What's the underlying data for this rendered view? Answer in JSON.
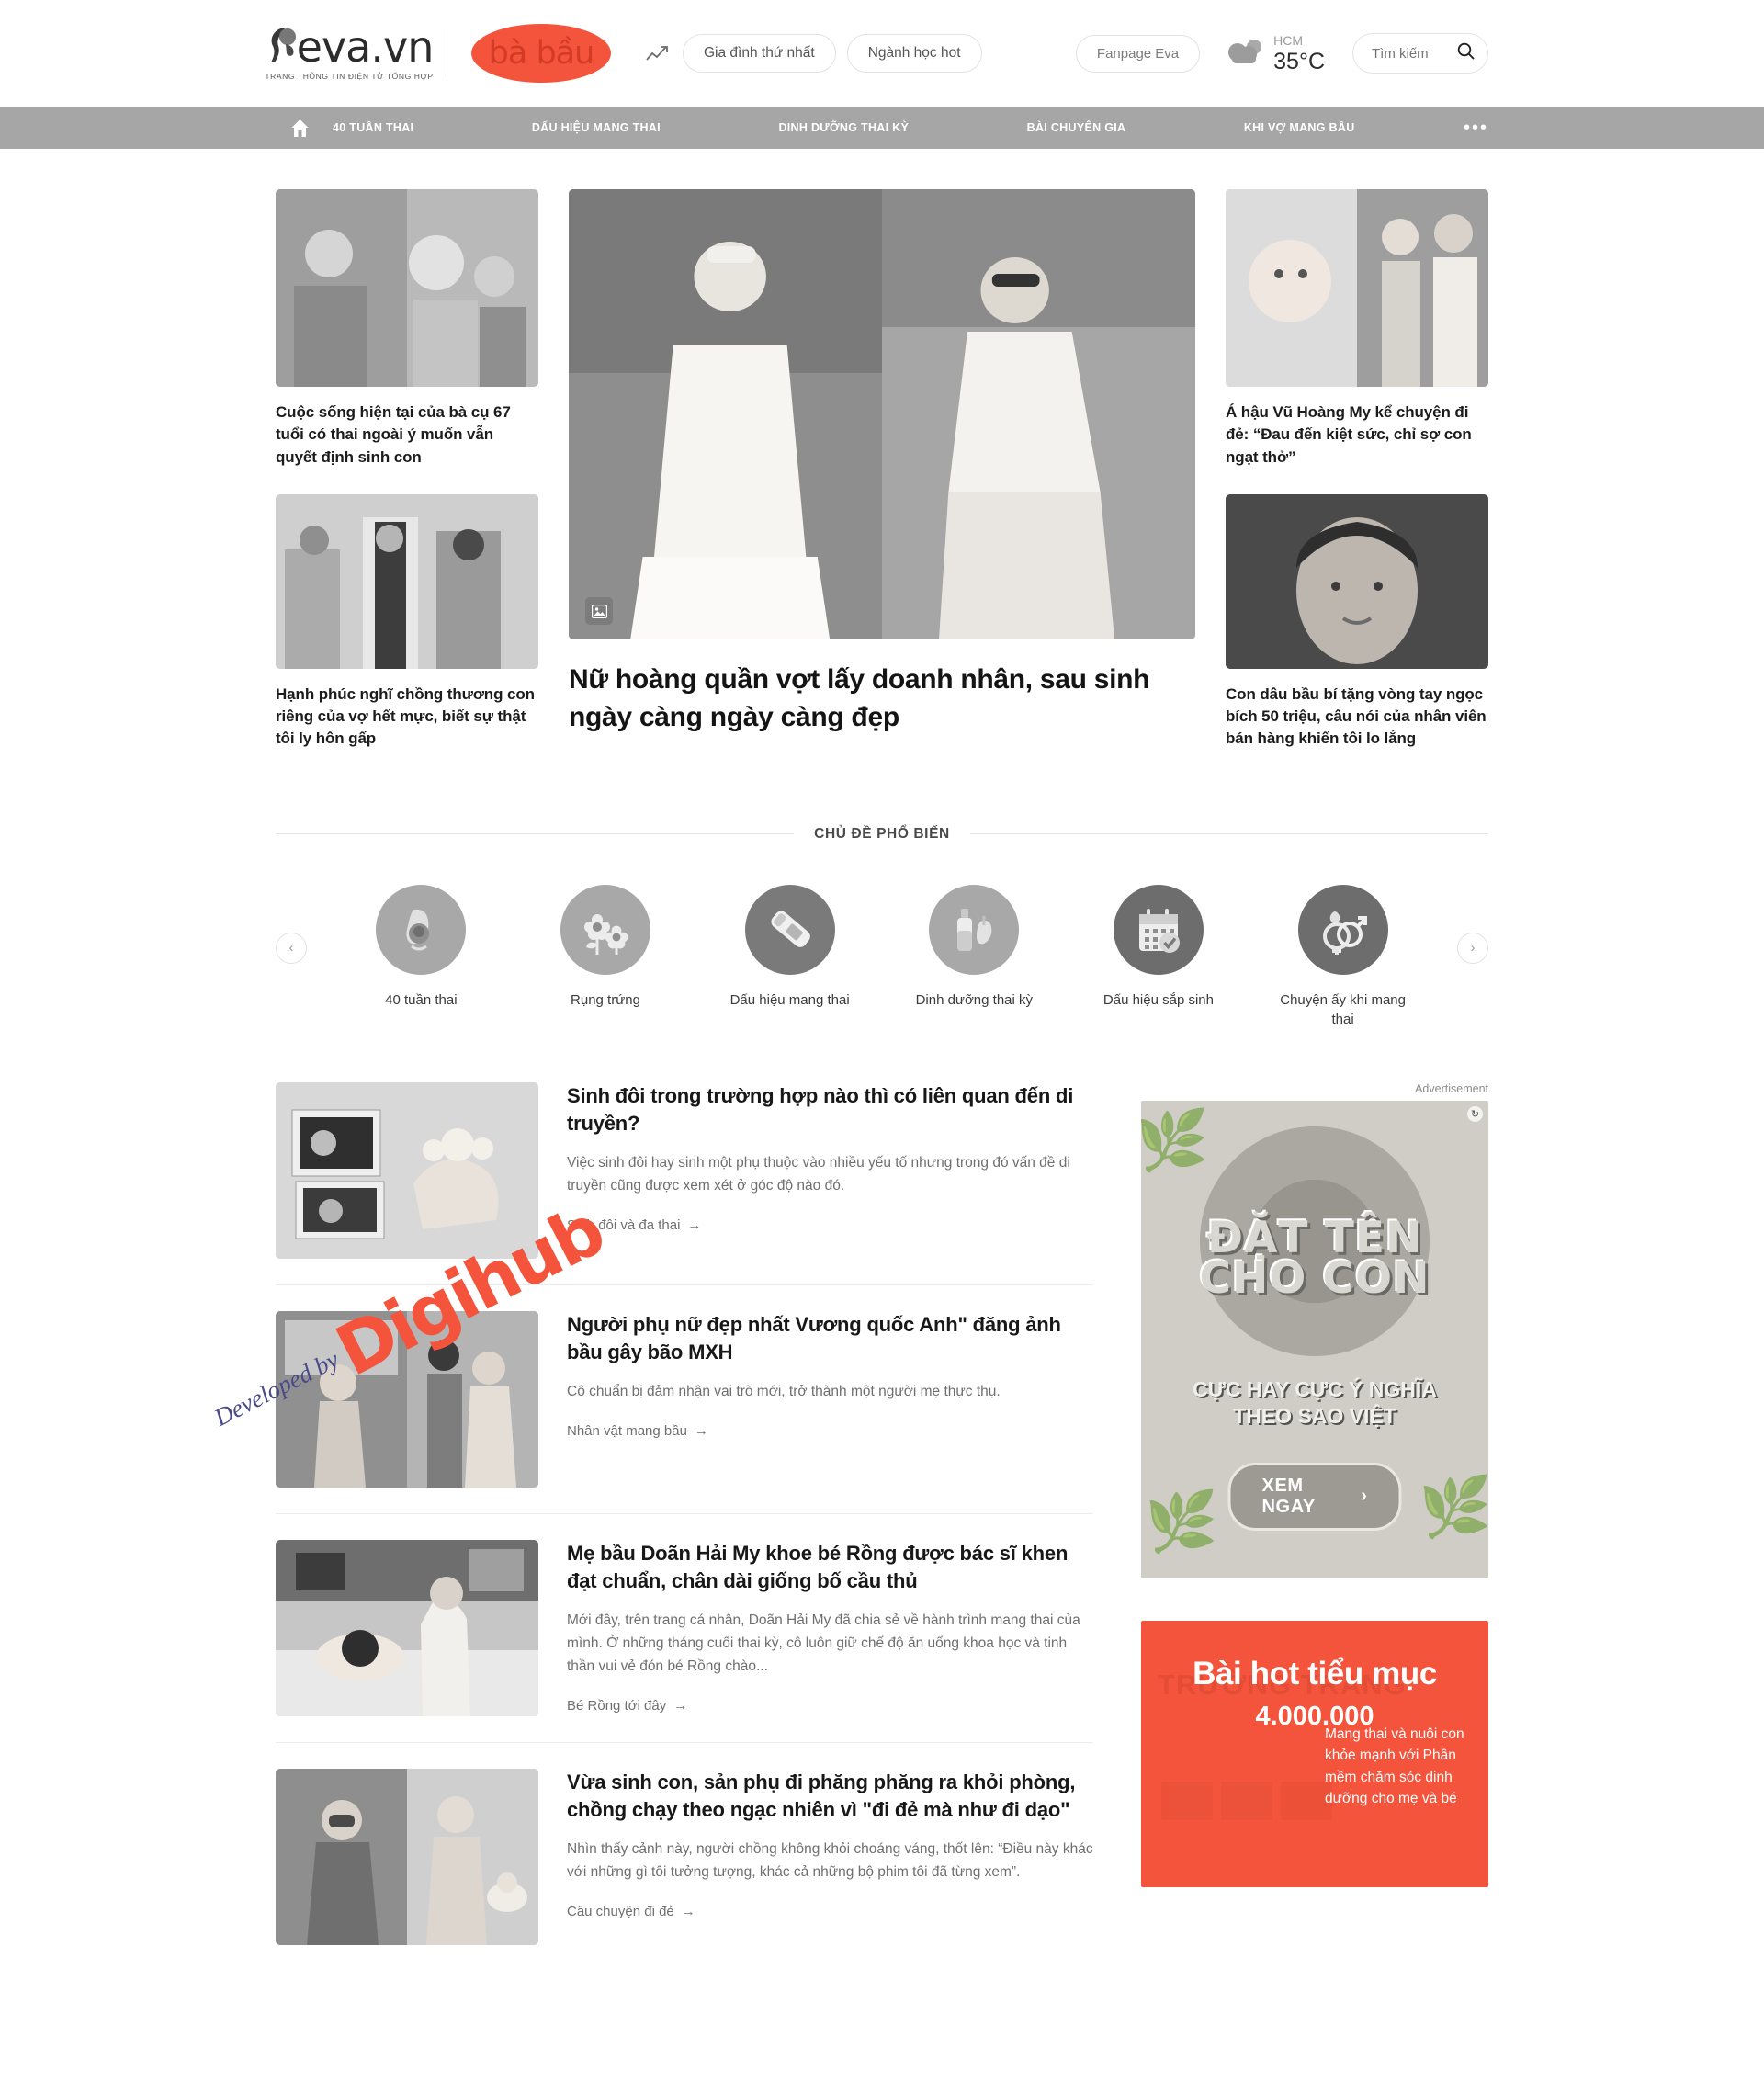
{
  "header": {
    "logo_text": "eva.vn",
    "logo_tagline": "TRANG THÔNG TIN ĐIỆN TỬ TỔNG HỢP",
    "sub_brand": "bà bầu",
    "trend_icon": "trending-up-icon",
    "pills": [
      "Gia đình thứ nhất",
      "Ngành học hot"
    ],
    "fanpage_label": "Fanpage Eva",
    "weather": {
      "city": "HCM",
      "temp": "35°C",
      "icon": "cloud-icon"
    },
    "search": {
      "placeholder": "Tìm kiếm",
      "value": "",
      "icon": "search-icon"
    }
  },
  "nav": {
    "home_icon": "home-icon",
    "items": [
      "40 TUẦN THAI",
      "DẤU HIỆU MANG THAI",
      "DINH DƯỠNG THAI KỲ",
      "BÀI CHUYÊN GIA",
      "KHI VỢ MANG BẦU"
    ],
    "more_label": "•••"
  },
  "hero": {
    "left": [
      {
        "title": "Cuộc sống hiện tại của bà cụ 67 tuổi có thai ngoài ý muốn vẫn quyết định sinh con"
      },
      {
        "title": "Hạnh phúc nghĩ chồng thương con riêng của vợ hết mực, biết sự thật tôi ly hôn gấp"
      }
    ],
    "main": {
      "title": "Nữ hoàng quần vợt lấy doanh nhân, sau sinh ngày càng ngày càng đẹp",
      "badge_icon": "photo-gallery-icon"
    },
    "right": [
      {
        "title": "Á hậu Vũ Hoàng My kể chuyện đi đẻ: “Đau đến kiệt sức, chỉ sợ con ngạt thở”"
      },
      {
        "title": "Con dâu bầu bí tặng vòng tay ngọc bích 50 triệu, câu nói của nhân viên bán hàng khiến tôi lo lắng"
      }
    ]
  },
  "topics_section": {
    "title": "CHỦ ĐỀ PHỔ BIẾN",
    "prev_icon": "chevron-left-icon",
    "next_icon": "chevron-right-icon",
    "items": [
      {
        "label": "40 tuần thai",
        "icon": "pregnant-belly-icon"
      },
      {
        "label": "Rụng trứng",
        "icon": "flowers-icon"
      },
      {
        "label": "Dấu hiệu mang thai",
        "icon": "pregnancy-test-icon"
      },
      {
        "label": "Dinh dưỡng thai kỳ",
        "icon": "nutrition-bottle-icon"
      },
      {
        "label": "Dấu hiệu sắp sinh",
        "icon": "calendar-check-icon"
      },
      {
        "label": "Chuyện ấy khi mang thai",
        "icon": "gender-symbols-icon"
      }
    ]
  },
  "articles": [
    {
      "title": "Sinh đôi trong trường hợp nào thì có liên quan đến di truyền?",
      "desc": "Việc sinh đôi hay sinh một phụ thuộc vào nhiều yếu tố nhưng trong đó vấn đề di truyền cũng được xem xét ở góc độ nào đó.",
      "tag": "Sinh đôi và đa thai"
    },
    {
      "title": "Người phụ nữ đẹp nhất Vương quốc Anh\" đăng ảnh bầu gây bão MXH",
      "desc": "Cô chuẩn bị đảm nhận vai trò mới, trở thành một người mẹ thực thụ.",
      "tag": "Nhân vật mang bầu"
    },
    {
      "title": "Mẹ bầu Doãn Hải My khoe bé Rồng được bác sĩ khen đạt chuẩn, chân dài giống bố cầu thủ",
      "desc": "Mới đây, trên trang cá nhân, Doãn Hải My đã chia sẻ về hành trình mang thai của mình. Ở những tháng cuối thai kỳ, cô luôn giữ chế độ ăn uống khoa học và tinh thần vui vẻ đón bé Rồng chào...",
      "tag": "Bé Rồng tới đây"
    },
    {
      "title": "Vừa sinh con, sản phụ đi phăng phăng ra khỏi phòng, chồng chạy theo ngạc nhiên vì \"đi đẻ mà như đi dạo\"",
      "desc": "Nhìn thấy cảnh này, người chồng không khỏi choáng váng, thốt lên: “Điều này khác với những gì tôi tưởng tượng, khác cả những bộ phim tôi đã từng xem”.",
      "tag": "Câu chuyện đi đẻ"
    }
  ],
  "sidebar": {
    "ad_label": "Advertisement",
    "adchoices_icon": "adchoices-icon",
    "ad": {
      "headline_line1": "ĐẶT TÊN",
      "headline_line2": "CHO CON",
      "sub_line1": "CỰC HAY CỰC Ý NGHĨA",
      "sub_line2": "THEO SAO VIỆT",
      "cta": "XEM NGAY",
      "cta_icon": "chevron-right-icon"
    },
    "promo": {
      "ghost_title": "TRƯỜNG TRANG",
      "title": "Bài hot tiểu mục",
      "number": "4.000.000",
      "body": "Mang thai và nuôi con khỏe mạnh với Phần mềm chăm sóc dinh dưỡng cho mẹ và bé"
    }
  },
  "watermark": {
    "text": "Developed by",
    "logo": "Digihub"
  },
  "colors": {
    "brand_red": "#f4543c",
    "nav_gray": "#a6a6a6",
    "text_dark": "#1a1a1a",
    "text_muted": "#6f6f6f"
  }
}
